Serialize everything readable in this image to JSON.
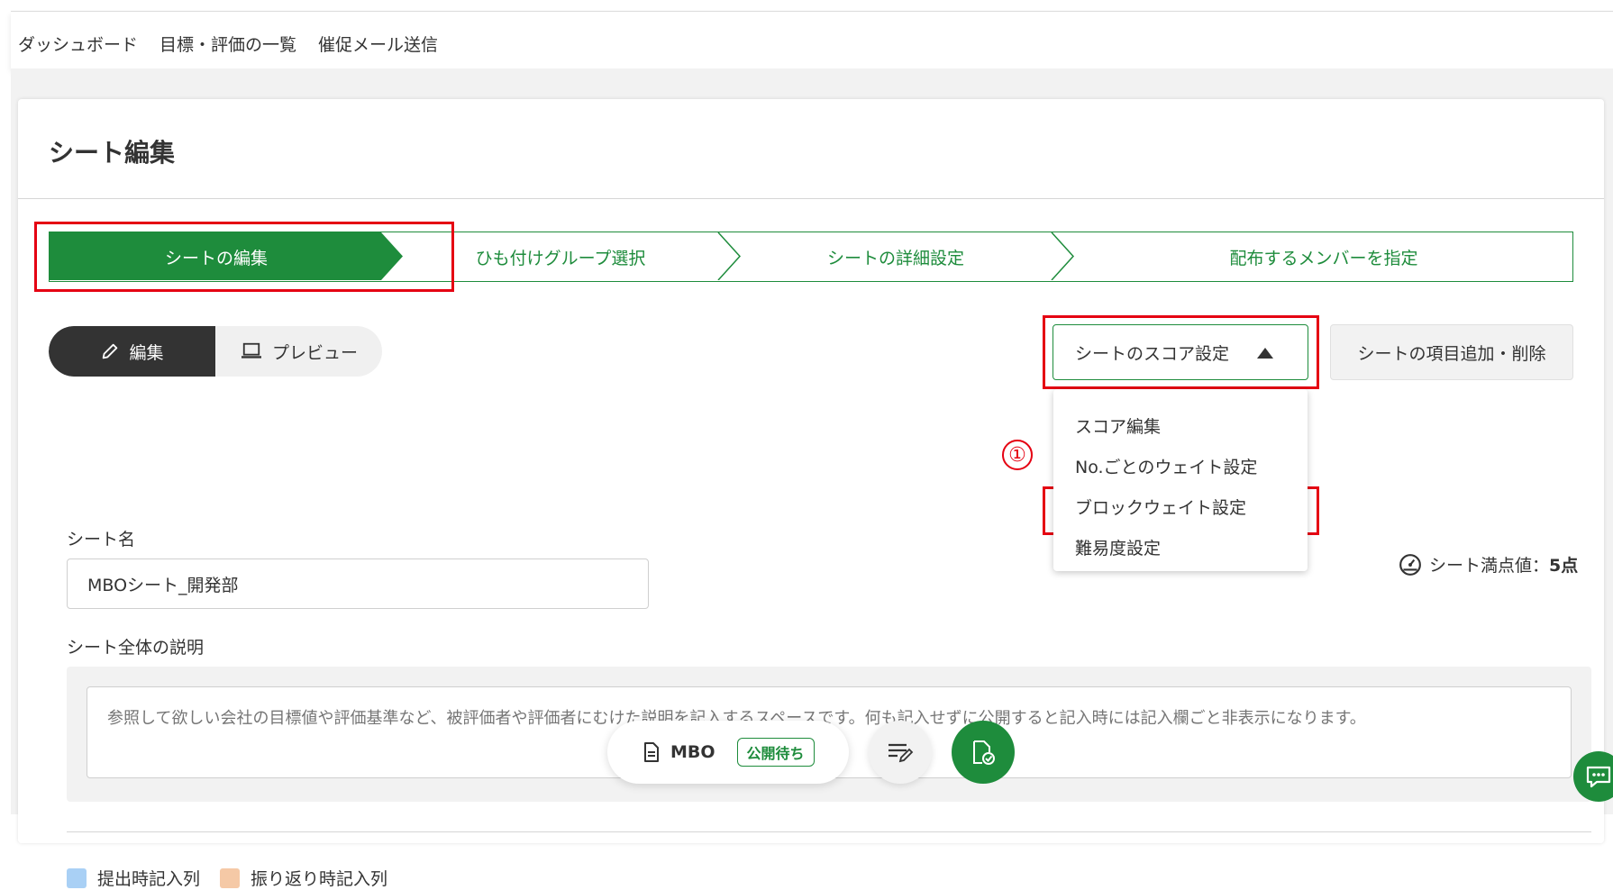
{
  "topnav": {
    "dashboard": "ダッシュボード",
    "goals_list": "目標・評価の一覧",
    "reminder": "催促メール送信"
  },
  "page_title": "シート編集",
  "steps": [
    {
      "label": "シートの編集",
      "active": true
    },
    {
      "label": "ひも付けグループ選択",
      "active": false
    },
    {
      "label": "シートの詳細設定",
      "active": false
    },
    {
      "label": "配布するメンバーを指定",
      "active": false
    }
  ],
  "mode_toggle": {
    "edit": "編集",
    "preview": "プレビュー"
  },
  "score_menu": {
    "button": "シートのスコア設定",
    "items": [
      "スコア編集",
      "No.ごとのウェイト設定",
      "ブロックウェイト設定",
      "難易度設定"
    ]
  },
  "item_button": "シートの項目追加・削除",
  "annotation_marker": "①",
  "full_score": {
    "label": "シート満点値：",
    "value": "5点"
  },
  "sheet_name": {
    "label": "シート名",
    "value": "MBOシート_開発部"
  },
  "description": {
    "label": "シート全体の説明",
    "placeholder": "参照して欲しい会社の目標値や評価基準など、被評価者や評価者にむけた説明を記入するスペースです。何も記入せずに公開すると記入時には記入欄ごと非表示になります。"
  },
  "legend": [
    {
      "label": "提出時記入列",
      "color": "#a9d0f5"
    },
    {
      "label": "振り返り時記入列",
      "color": "#f5c9a6"
    }
  ],
  "bottom_bar": {
    "sheet_type": "MBO",
    "status": "公開待ち"
  },
  "colors": {
    "brand_green": "#1e8c3c",
    "highlight_red": "#e50012"
  }
}
